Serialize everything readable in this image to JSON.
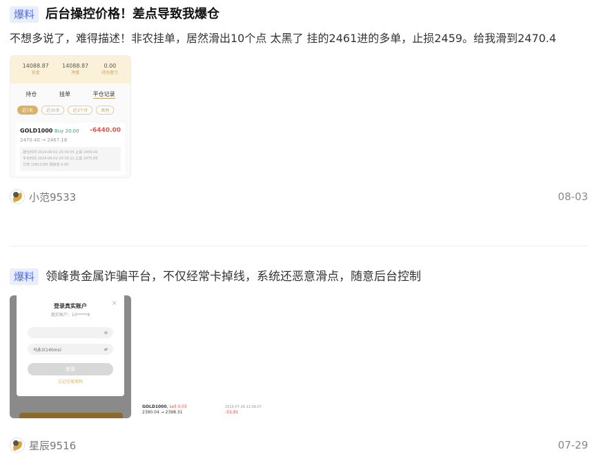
{
  "posts": [
    {
      "badge": "爆料",
      "title": "后台操控价格！差点导致我爆仓",
      "body": "不想多说了，难得描述！非农挂单，居然滑出10个点 太黑了 挂的2461进的多单，止损2459。给我滑到2470.4",
      "thumbnail": {
        "top_cells": [
          {
            "value": "14088.87",
            "label": "总金"
          },
          {
            "value": "14088.87",
            "label": "净值"
          },
          {
            "value": "0.00",
            "label": "持仓盈亏"
          }
        ],
        "tabs": [
          "持仓",
          "挂单",
          "平仓记录"
        ],
        "pills": [
          "近7天",
          "近30天",
          "近3个月",
          "其他"
        ],
        "symbol": "GOLD1000",
        "side": "Buy 20.00",
        "pnl": "-6440.00",
        "prices": "2470.40 → 2467.18",
        "detail_lines": [
          "建仓时间 2024-08-02 20:30:05    止损 2459.00",
          "平仓时间 2024-08-02 20:30:11    止盈 2475.89",
          "订单 10812345                      隔夜息 0.00"
        ]
      },
      "author": "小范9533",
      "date": "08-03"
    },
    {
      "badge": "爆料",
      "title": "领峰贵金属诈骗平台，不仅经常卡掉线，系统还恶意滑点，随意后台控制",
      "thumbnail": {
        "dialog_title": "登录真实账户",
        "dialog_sub": "真实账户：10*****8",
        "close": "×",
        "input_placeholder": "",
        "input2_value": "马永3(140ms)",
        "button": "登录",
        "link": "忘记交易密码"
      },
      "mini": {
        "symbol": "GOLD1000",
        "side": "sell 0.03",
        "prices": "2390.04 → 2398.31",
        "time": "2024-07-26 11:56:07",
        "pnl": "-53.91"
      },
      "author": "星辰9516",
      "date": "07-29"
    }
  ],
  "icons": {
    "avatar": "eagle-avatar-icon",
    "eye": "eye-off-icon",
    "swap": "swap-icon"
  },
  "colors": {
    "badge_text": "#4a6cf7",
    "badge_bg": "#e9eefc",
    "gold": "#d9b26a",
    "loss": "#e5534b",
    "buy": "#2eae6a"
  }
}
